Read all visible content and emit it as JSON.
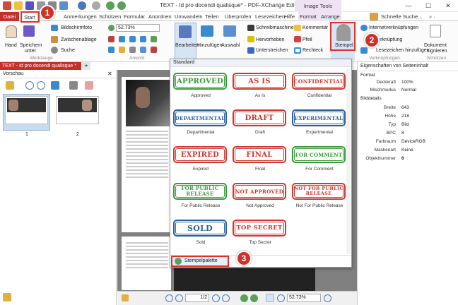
{
  "window": {
    "title": "TEXT - Id pro docendi qualisque* - PDF-XChange Editor",
    "context_tab": "Image Tools"
  },
  "tabs": [
    "Datei",
    "Start",
    "Anmerkungen",
    "Schützen",
    "Formular",
    "Anordnen",
    "Umwandeln",
    "Teilen",
    "Überprüfen",
    "Lesezeichen",
    "Hilfe",
    "Format",
    "Arrange"
  ],
  "search_label": "Schnelle Suche...",
  "ribbon": {
    "hand": "Hand",
    "speichern": "Speichern",
    "unter": "unter",
    "bildschirmfoto": "Bildschirmfoto",
    "zwischenablage": "Zwischenablage",
    "suche": "Suche",
    "zoom": "52.73%",
    "bearbeiten": "Bearbeiten",
    "hinzufuegen": "Hinzufügen",
    "auswahl": "Auswahl",
    "schreibmaschine": "Schreibmaschine",
    "hervorheben": "Hervorheben",
    "unterstreichen": "Unterstreichen",
    "kommentar": "Kommentar",
    "pfeil": "Pfeil",
    "rechteck": "Rechteck",
    "stempel": "Stempel",
    "internet": "Internetverknüpfungen",
    "verknuepfung": "Verknüpfung",
    "lesezeichen_hinzu": "Lesezeichen hinzufügen",
    "dokument": "Dokument",
    "signieren": "signieren",
    "group_werkzeuge": "Werkzeuge",
    "group_ansicht": "Ansicht",
    "group_verknuepfungen": "Verknüpfungen",
    "group_schuetzen": "Schützen"
  },
  "doc_tab": "TEXT - Id pro docendi qualisque *",
  "left_panel": {
    "title": "Vorschau",
    "pages": [
      "1",
      "2"
    ]
  },
  "right_panel": {
    "title": "Eigenschaften von Seiteninhalt",
    "section_format": "Format",
    "deckkraft_label": "Deckkraft",
    "deckkraft_value": "100%",
    "mischmodus_label": "Mischmodus",
    "mischmodus_value": "Normal",
    "section_bild": "Bilddetails",
    "breite_label": "Breite",
    "breite_value": "643",
    "hoehe_label": "Höhe",
    "hoehe_value": "218",
    "typ_label": "Typ",
    "typ_value": "Bild",
    "bpc_label": "BPC",
    "bpc_value": "8",
    "farbraum_label": "Farbraum",
    "farbraum_value": "DeviceRGB",
    "maskenart_label": "Maskenart",
    "maskenart_value": "Keine",
    "objnr_label": "Objektnummer",
    "objnr_value": "6"
  },
  "stamps_menu": {
    "section": "Standard",
    "stamps": [
      {
        "text": "APPROVED",
        "name": "Approved",
        "color": "#3a9a3a"
      },
      {
        "text": "AS IS",
        "name": "As Is",
        "color": "#d0382e"
      },
      {
        "text": "CONFIDENTIAL",
        "name": "Confidential",
        "color": "#d0382e"
      },
      {
        "text": "DEPARTMENTAL",
        "name": "Departmental",
        "color": "#2a5f9e"
      },
      {
        "text": "DRAFT",
        "name": "Draft",
        "color": "#d0382e"
      },
      {
        "text": "EXPERIMENTAL",
        "name": "Experimental",
        "color": "#2a5f9e"
      },
      {
        "text": "EXPIRED",
        "name": "Expired",
        "color": "#d0382e"
      },
      {
        "text": "FINAL",
        "name": "Final",
        "color": "#d0382e"
      },
      {
        "text": "FOR COMMENT",
        "name": "For Comment",
        "color": "#3a9a3a"
      },
      {
        "text": "FOR PUBLIC RELEASE",
        "name": "For Public Release",
        "color": "#3a9a3a"
      },
      {
        "text": "NOT APPROVED",
        "name": "Not Approved",
        "color": "#d0382e"
      },
      {
        "text": "NOT FOR PUBLIC RELEASE",
        "name": "Not For Public Release",
        "color": "#d0382e"
      },
      {
        "text": "SOLD",
        "name": "Sold",
        "color": "#2a5f9e"
      },
      {
        "text": "TOP SECRET",
        "name": "Top Secret",
        "color": "#d0382e"
      }
    ],
    "palette": "Stempelpalette"
  },
  "badges": [
    "1",
    "2",
    "3"
  ],
  "status": {
    "page": "1/2",
    "zoom": "52.73%"
  },
  "colors": {
    "accent_red": "#c4302b",
    "badge_red": "#d0312b",
    "context_purple": "#eee3f3"
  }
}
